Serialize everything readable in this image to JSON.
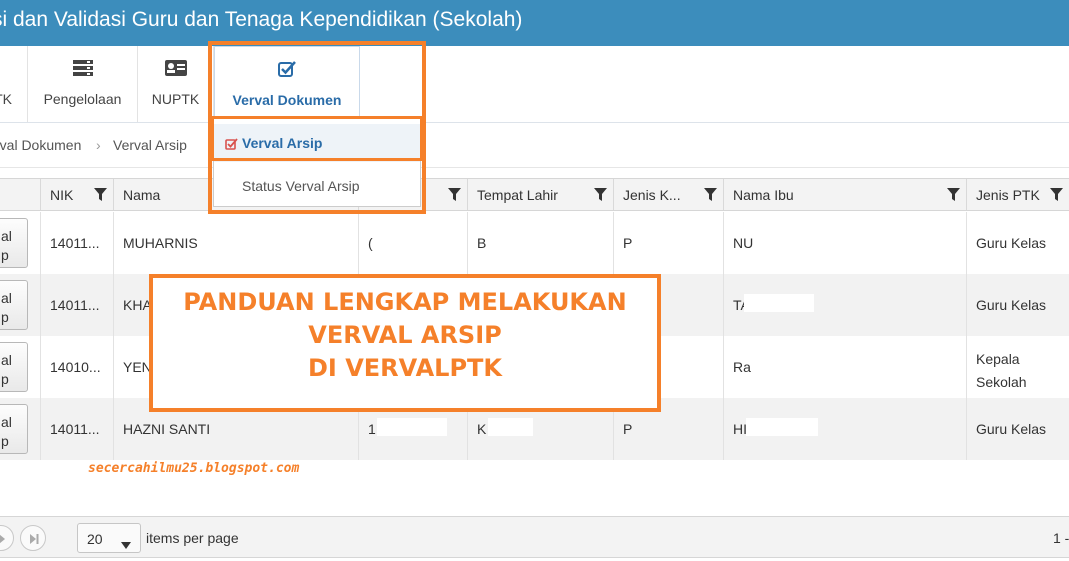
{
  "app": {
    "title": "si dan Validasi Guru dan Tenaga Kependidikan (Sekolah)"
  },
  "toolbar": {
    "items": [
      {
        "label": "TK",
        "icon": "truncated-icon"
      },
      {
        "label": "Pengelolaan",
        "icon": "server-icon"
      },
      {
        "label": "NUPTK",
        "icon": "id-card-icon"
      },
      {
        "label": "Verval Dokumen",
        "icon": "checkbox-icon",
        "active": true
      }
    ]
  },
  "breadcrumb": {
    "items": [
      "rval Dokumen",
      "Verval Arsip"
    ],
    "separator": "›"
  },
  "dropdown": {
    "items": [
      {
        "label": "Verval Arsip",
        "selected": true,
        "icon": "checkbox-icon"
      },
      {
        "label": "Status Verval Arsip",
        "selected": false
      }
    ]
  },
  "grid": {
    "columns": [
      "NIK",
      "Nama",
      "",
      "Tempat Lahir",
      "Jenis K...",
      "Nama Ibu",
      "Jenis PTK"
    ],
    "row_button_label": "al\np",
    "rows": [
      {
        "nik": "14011...",
        "nama": "MUHARNIS",
        "tgl": "(",
        "tempat": "B",
        "jk": "P",
        "ibu": "NU",
        "jenis": "Guru Kelas"
      },
      {
        "nik": "14011...",
        "nama": "KHA",
        "tgl": "",
        "tempat": "",
        "jk": "",
        "ibu": "TA",
        "jenis": "Guru Kelas"
      },
      {
        "nik": "14010...",
        "nama": "YEN",
        "tgl": "",
        "tempat": "",
        "jk": "",
        "ibu": "Ra",
        "jenis": "Kepala\nSekolah"
      },
      {
        "nik": "14011...",
        "nama": "HAZNI SANTI",
        "tgl": "1",
        "tempat": "K",
        "jk": "P",
        "ibu": "HI",
        "jenis": "Guru Kelas"
      }
    ]
  },
  "pager": {
    "page_size": "20",
    "items_per_page_label": "items per page",
    "range_text": "1 -"
  },
  "overlay": {
    "watermark": "secercahilmu25.blogspot.com",
    "banner_lines": [
      "PANDUAN LENGKAP MELAKUKAN",
      "VERVAL ARSIP",
      "DI VERVALPTK"
    ],
    "accent_color": "#f5802a"
  },
  "colors": {
    "header_bg": "#3c8dbc",
    "active_link": "#2a6ca8"
  }
}
